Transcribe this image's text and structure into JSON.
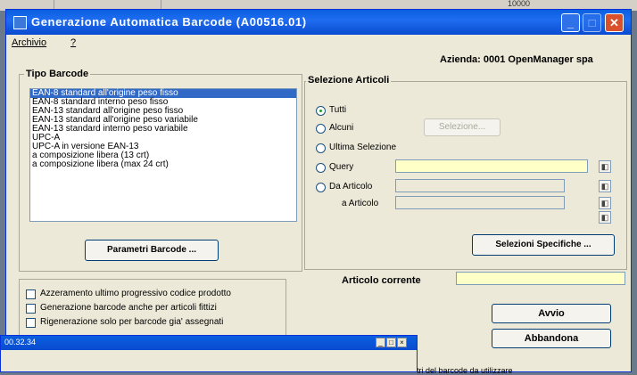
{
  "window": {
    "title": "Generazione Automatica Barcode  (A00516.01)"
  },
  "menu": {
    "archivio": "Archivio",
    "help": "?"
  },
  "azienda": "Azienda: 0001 OpenManager spa",
  "tipo_barcode": {
    "title": "Tipo Barcode",
    "items": [
      "EAN-8  standard all'origine peso fisso",
      "EAN-8  standard interno    peso fisso",
      "EAN-13 standard all'origine peso fisso",
      "EAN-13 standard all'origine peso variabile",
      "EAN-13 standard interno    peso variabile",
      "UPC-A",
      "UPC-A  in versione EAN-13",
      "a composizione libera (13 crt)",
      "a composizione libera (max 24 crt)"
    ],
    "selected_index": 0,
    "parametri_button": "Parametri Barcode ..."
  },
  "selezione_articoli": {
    "title": "Selezione Articoli",
    "options": {
      "tutti": "Tutti",
      "alcuni": "Alcuni",
      "ultima": "Ultima Selezione",
      "query": "Query",
      "da_articolo": "Da  Articolo",
      "a_articolo": "a  Articolo"
    },
    "selected": "tutti",
    "selezione_button": "Selezione...",
    "selezioni_specifiche_button": "Selezioni Specifiche ..."
  },
  "articolo_corrente_label": "Articolo corrente",
  "options": {
    "azzeramento": "Azzeramento ultimo progressivo codice prodotto",
    "generazione": "Generazione barcode anche per articoli fittizi",
    "rigenerazione": "Rigenerazione solo per barcode gia' assegnati"
  },
  "buttons": {
    "avvio": "Avvio",
    "abbandona": "Abbandona"
  },
  "overlay": {
    "title": "00.32.34",
    "text": ""
  },
  "bottom_text": "tri del barcode da utilizzare",
  "background_text": "10000",
  "colors": {
    "titlebar": "#0a5fe0",
    "selection": "#3169c6",
    "field_yellow": "#ffffc8",
    "window_bg": "#ece9d8"
  }
}
